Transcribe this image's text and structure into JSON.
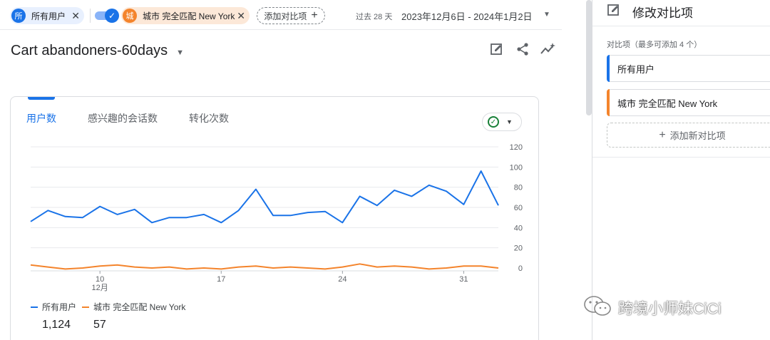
{
  "comparisons_bar": {
    "chip_all": {
      "badge": "所",
      "label": "所有用户",
      "close": "✕"
    },
    "chip_ny": {
      "badge": "城",
      "label": "城市 完全匹配 New York",
      "close": "✕"
    },
    "add_compare_label": "添加对比项",
    "add_compare_plus": "+"
  },
  "date": {
    "prefix": "过去 28 天",
    "range": "2023年12月6日 - 2024年1月2日"
  },
  "report": {
    "title": "Cart abandoners-60days"
  },
  "card": {
    "tabs": [
      "用户数",
      "感兴趣的会话数",
      "转化次数"
    ],
    "legend": [
      {
        "name": "所有用户",
        "total": "1,124",
        "color": "#1a73e8"
      },
      {
        "name": "城市 完全匹配 New York",
        "total": "57",
        "color": "#f4842c"
      }
    ]
  },
  "chart_data": {
    "type": "line",
    "x_tick_labels": [
      "10",
      "17",
      "24",
      "31"
    ],
    "x_month_label": "12月",
    "y_tick_labels": [
      "120",
      "100",
      "80",
      "60",
      "40",
      "20",
      "0"
    ],
    "ylim": [
      0,
      120
    ],
    "grid": true,
    "legend_position": "bottom-left",
    "series": [
      {
        "name": "所有用户",
        "color": "#1a73e8",
        "values": [
          46,
          57,
          51,
          50,
          61,
          53,
          58,
          45,
          50,
          50,
          53,
          45,
          57,
          78,
          52,
          52,
          55,
          56,
          45,
          71,
          62,
          77,
          71,
          82,
          76,
          63,
          96,
          62
        ]
      },
      {
        "name": "城市 完全匹配 New York",
        "color": "#f4842c",
        "values": [
          3,
          1,
          -1,
          0,
          2,
          3,
          1,
          0,
          1,
          -1,
          0,
          -1,
          1,
          2,
          0,
          1,
          0,
          -1,
          1,
          4,
          1,
          2,
          1,
          -1,
          0,
          2,
          2,
          0
        ]
      }
    ]
  },
  "panel": {
    "title": "修改对比项",
    "subtitle": "对比项（最多可添加 4 个）",
    "items": [
      "所有用户",
      "城市 完全匹配 New York"
    ],
    "add_label": "添加新对比项",
    "add_plus": "+"
  },
  "watermark": {
    "text": "跨境小师妹CiCi"
  },
  "icons": {
    "edit": "edit-report-icon",
    "share": "share-icon",
    "insights": "insights-icon",
    "panel_edit": "edit-comparison-icon",
    "wechat": "wechat-icon"
  }
}
